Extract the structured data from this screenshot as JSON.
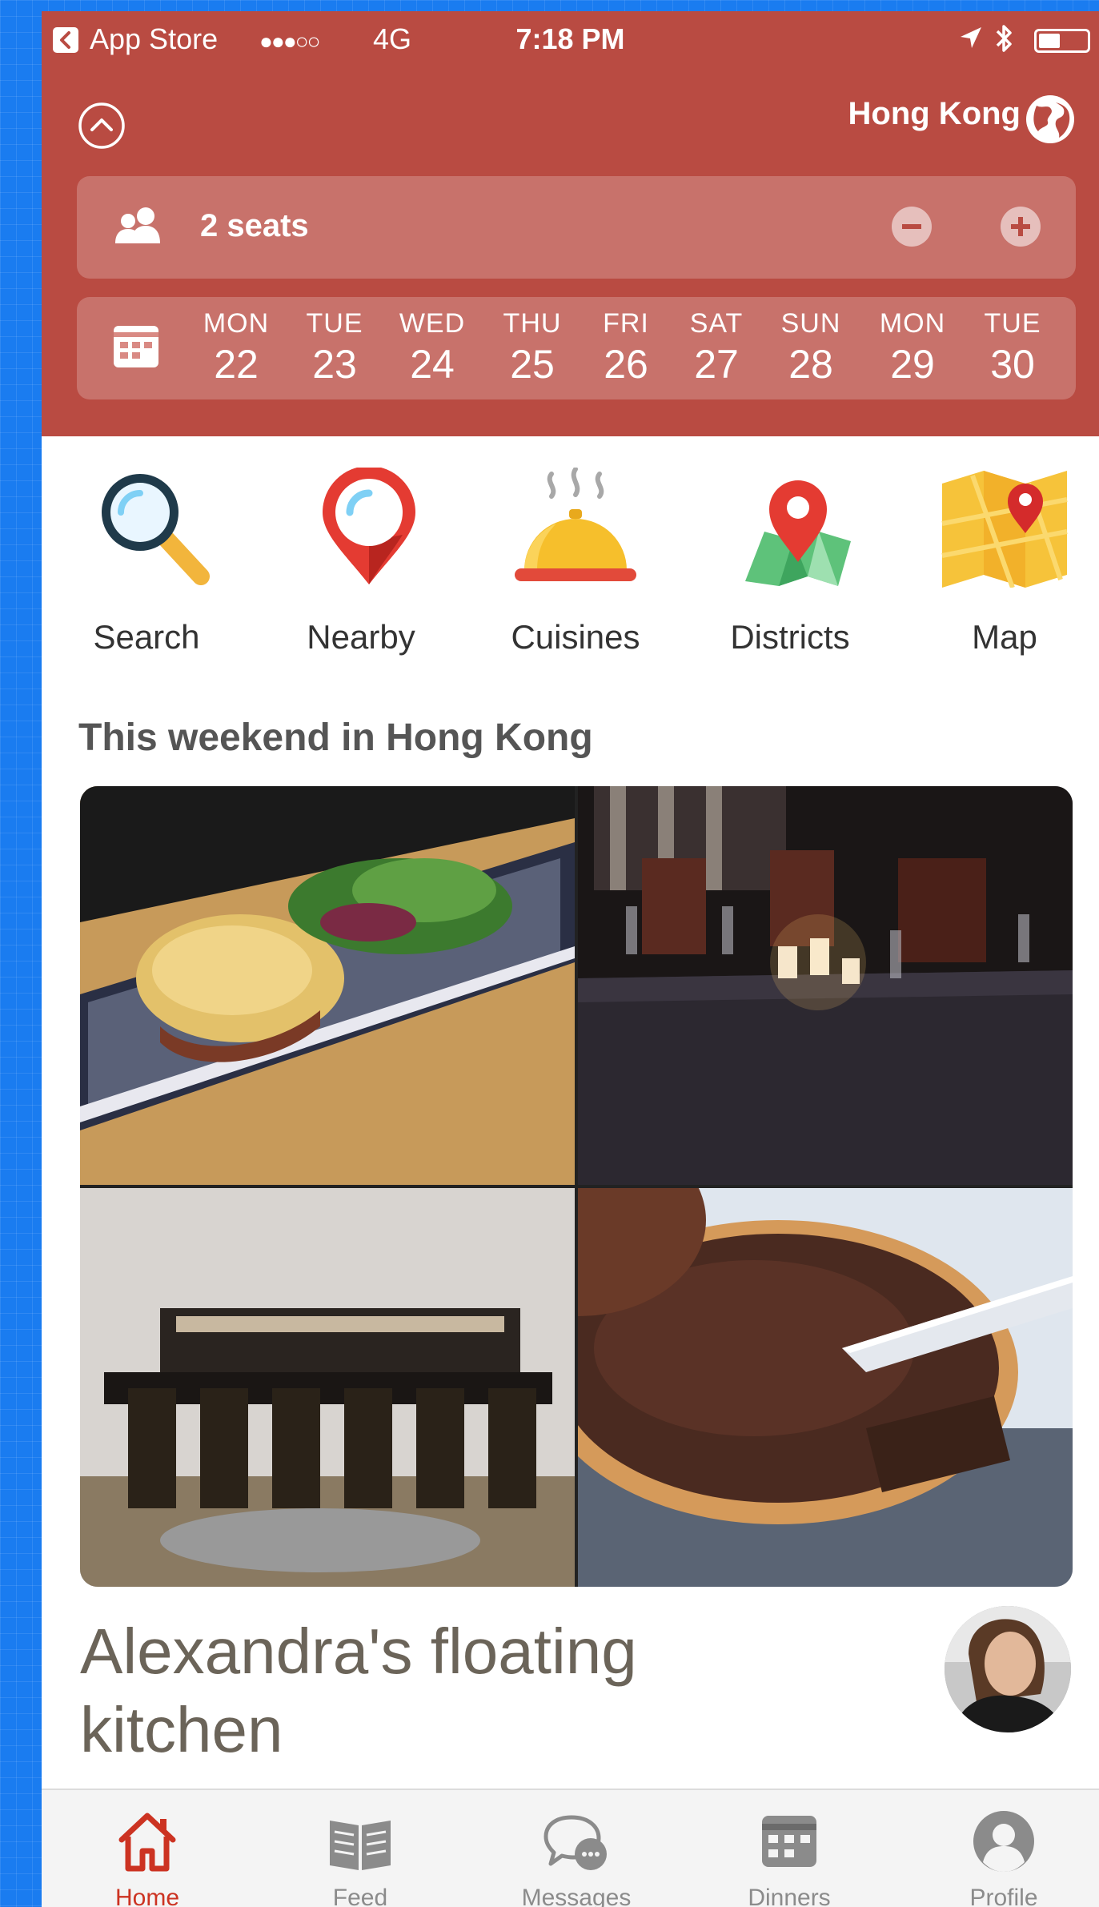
{
  "status_bar": {
    "carrier": "App Store",
    "signal": "●●●○○",
    "network": "4G",
    "time": "7:18 PM",
    "battery_level": 0.45
  },
  "header": {
    "city": "Hong Kong",
    "seats_label": "2 seats",
    "dates": [
      {
        "day": "MON",
        "num": "22"
      },
      {
        "day": "TUE",
        "num": "23"
      },
      {
        "day": "WED",
        "num": "24"
      },
      {
        "day": "THU",
        "num": "25"
      },
      {
        "day": "FRI",
        "num": "26"
      },
      {
        "day": "SAT",
        "num": "27"
      },
      {
        "day": "SUN",
        "num": "28"
      },
      {
        "day": "MON",
        "num": "29"
      },
      {
        "day": "TUE",
        "num": "30"
      }
    ]
  },
  "categories": [
    {
      "label": "Search",
      "icon": "search-icon"
    },
    {
      "label": "Nearby",
      "icon": "map-pin-icon"
    },
    {
      "label": "Cuisines",
      "icon": "cloche-icon"
    },
    {
      "label": "Districts",
      "icon": "district-map-icon"
    },
    {
      "label": "Map",
      "icon": "folded-map-icon"
    }
  ],
  "section": {
    "title": "This weekend in Hong Kong"
  },
  "dinner": {
    "title": "Alexandra's floating kitchen"
  },
  "tabs": [
    {
      "label": "Home",
      "icon": "home-icon",
      "active": true
    },
    {
      "label": "Feed",
      "icon": "book-icon",
      "active": false
    },
    {
      "label": "Messages",
      "icon": "chat-bubble-icon",
      "active": false
    },
    {
      "label": "Dinners",
      "icon": "calendar-icon",
      "active": false
    },
    {
      "label": "Profile",
      "icon": "person-icon",
      "active": false
    }
  ],
  "colors": {
    "brand": "#b94b42",
    "tab_active": "#cc3322",
    "tab_inactive": "#8b8b8b"
  }
}
